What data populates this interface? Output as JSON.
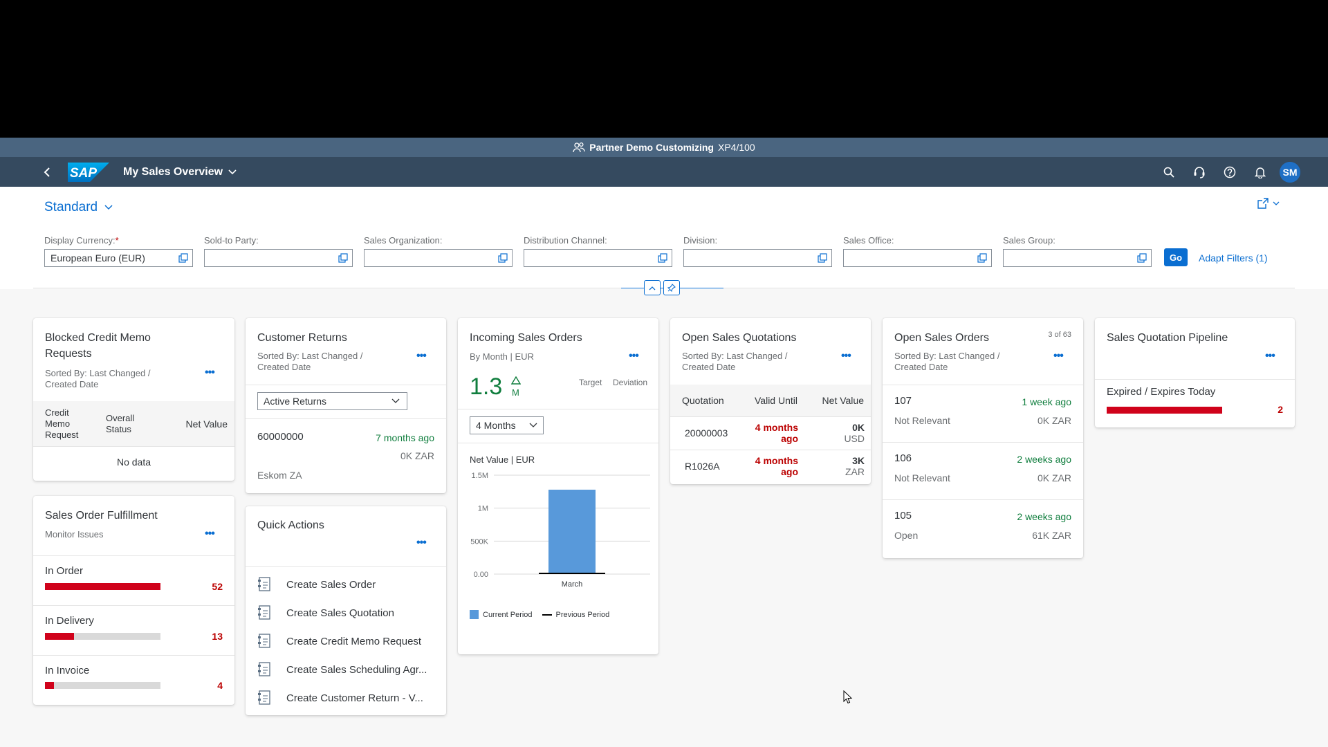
{
  "system": {
    "name": "Partner Demo Customizing",
    "client": "XP4/100"
  },
  "shell": {
    "app_title": "My Sales Overview",
    "user_initials": "SM"
  },
  "header": {
    "variant": "Standard",
    "filters": [
      {
        "label": "Display Currency:",
        "required": "*",
        "value": "European Euro (EUR)"
      },
      {
        "label": "Sold-to Party:",
        "value": ""
      },
      {
        "label": "Sales Organization:",
        "value": ""
      },
      {
        "label": "Distribution Channel:",
        "value": ""
      },
      {
        "label": "Division:",
        "value": ""
      },
      {
        "label": "Sales Office:",
        "value": ""
      },
      {
        "label": "Sales Group:",
        "value": ""
      }
    ],
    "go": "Go",
    "adapt_filters": "Adapt Filters (1)"
  },
  "cards": {
    "blocked_credit": {
      "title_line1": "Blocked Credit Memo",
      "title_line2": "Requests",
      "sub_line1": "Sorted By: Last Changed /",
      "sub_line2": "Created Date",
      "col1_line1": "Credit",
      "col1_line2": "Memo",
      "col1_line3": "Request",
      "col2_line1": "Overall",
      "col2_line2": "Status",
      "col3": "Net Value",
      "empty": "No data"
    },
    "fulfillment": {
      "title": "Sales Order Fulfillment",
      "sub": "Monitor Issues",
      "items": [
        {
          "label": "In Order",
          "value": "52",
          "fraction": 1.0
        },
        {
          "label": "In Delivery",
          "value": "13",
          "fraction": 0.25
        },
        {
          "label": "In Invoice",
          "value": "4",
          "fraction": 0.08
        }
      ]
    },
    "returns": {
      "title": "Customer Returns",
      "sub_line1": "Sorted By: Last Changed /",
      "sub_line2": "Created Date",
      "select": "Active Returns",
      "item": {
        "id": "60000000",
        "time": "7 months ago",
        "amount": "0K ZAR",
        "customer": "Eskom ZA"
      }
    },
    "quick_actions": {
      "title": "Quick Actions",
      "actions": [
        "Create Sales Order",
        "Create Sales Quotation",
        "Create Credit Memo Request",
        "Create Sales Scheduling Agr...",
        "Create Customer Return - V..."
      ]
    },
    "incoming": {
      "title": "Incoming Sales Orders",
      "sub": "By Month | EUR",
      "kpi_value": "1.3",
      "kpi_unit": "M",
      "target_label": "Target",
      "deviation_label": "Deviation",
      "select": "4 Months",
      "chart_title": "Net Value | EUR",
      "legend_current": "Current Period",
      "legend_previous": "Previous Period"
    },
    "quotations": {
      "title": "Open Sales Quotations",
      "sub_line1": "Sorted By: Last Changed /",
      "sub_line2": "Created Date",
      "columns": [
        "Quotation",
        "Valid Until",
        "Net Value"
      ],
      "rows": [
        {
          "id": "20000003",
          "valid_line1": "4 months",
          "valid_line2": "ago",
          "value": "0K",
          "currency": "USD"
        },
        {
          "id": "R1026A",
          "valid_line1": "4 months",
          "valid_line2": "ago",
          "value": "3K",
          "currency": "ZAR"
        }
      ]
    },
    "open_orders": {
      "title": "Open Sales Orders",
      "count": "3 of 63",
      "sub_line1": "Sorted By: Last Changed /",
      "sub_line2": "Created Date",
      "items": [
        {
          "id": "107",
          "time": "1 week ago",
          "status": "Not Relevant",
          "amount": "0K ZAR"
        },
        {
          "id": "106",
          "time": "2 weeks ago",
          "status": "Not Relevant",
          "amount": "0K ZAR"
        },
        {
          "id": "105",
          "time": "2 weeks ago",
          "status": "Open",
          "amount": "61K ZAR"
        }
      ]
    },
    "pipeline": {
      "title": "Sales Quotation Pipeline",
      "item": {
        "label": "Expired / Expires Today",
        "value": "2",
        "fraction": 1.0
      }
    }
  },
  "chart_data": {
    "type": "bar",
    "title": "Net Value | EUR",
    "categories": [
      "March"
    ],
    "series": [
      {
        "name": "Current Period",
        "values": [
          1280000
        ]
      }
    ],
    "y_ticks": [
      "0.00",
      "500K",
      "1M",
      "1.5M"
    ],
    "ylim": [
      0,
      1500000
    ],
    "grid": true,
    "legend": "bottom"
  },
  "colors": {
    "accent": "#0a6ed1",
    "negative": "#bb0000",
    "positive": "#107e3e",
    "shell": "#354a5f",
    "bar": "#5899da"
  }
}
